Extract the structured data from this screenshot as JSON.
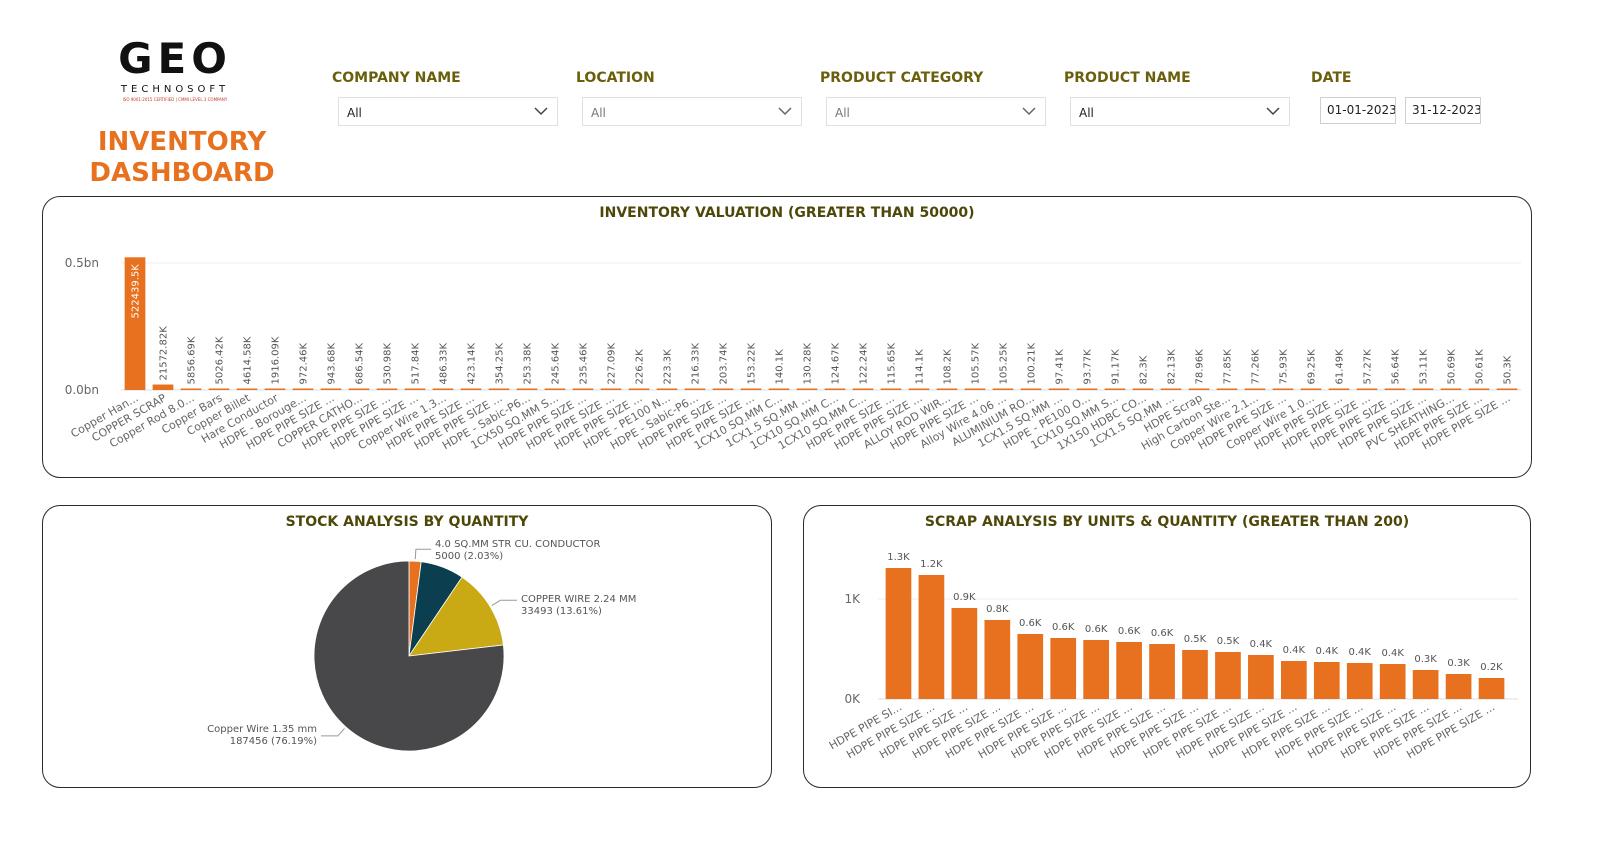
{
  "brand": {
    "logo_text": "GEO",
    "logo_sub": "TECHNOSOFT",
    "logo_cert": "ISO 9001:2015 CERTIFIED | CMMI LEVEL 3 COMPANY",
    "title_line1": "INVENTORY",
    "title_line2": "DASHBOARD"
  },
  "filters": {
    "company": {
      "label": "COMPANY NAME",
      "value": "All"
    },
    "location": {
      "label": "LOCATION",
      "value": "All"
    },
    "category": {
      "label": "PRODUCT CATEGORY",
      "value": "All"
    },
    "product": {
      "label": "PRODUCT NAME",
      "value": "All"
    },
    "date": {
      "label": "DATE",
      "from": "01-01-2023",
      "to": "31-12-2023"
    }
  },
  "colors": {
    "accent": "#e8711f",
    "title": "#4e470a",
    "pie": [
      "#e8711f",
      "#0b3f4f",
      "#c9a914",
      "#48484a"
    ]
  },
  "chart_data": [
    {
      "type": "bar",
      "title": "INVENTORY VALUATION (GREATER THAN 50000)",
      "yticks": [
        "0.0bn",
        "0.5bn"
      ],
      "ylim": [
        0,
        0.5
      ],
      "categories": [
        "Copper Han...",
        "COPPER SCRAP",
        "Copper Rod 8.0...",
        "Copper Bars",
        "Copper Billet",
        "Hare Conductor",
        "HDPE - Borouge...",
        "HDPE PIPE SIZE ...",
        "COPPER CATHO...",
        "HDPE PIPE SIZE ...",
        "HDPE PIPE SIZE ...",
        "Copper Wire 1.3...",
        "HDPE PIPE SIZE ...",
        "HDPE PIPE SIZE ...",
        "HDPE - Sabic-P6...",
        "1CX50 SQ.MM S...",
        "HDPE PIPE SIZE ...",
        "HDPE PIPE SIZE ...",
        "HDPE PIPE SIZE ...",
        "HDPE - PE100 N...",
        "HDPE - Sabic-P6...",
        "HDPE PIPE SIZE ...",
        "HDPE PIPE SIZE ...",
        "1CX10 SQ.MM C...",
        "1CX1.5 SQ.MM ...",
        "1CX10 SQ.MM C...",
        "1CX10 SQ.MM C...",
        "HDPE PIPE SIZE ...",
        "HDPE PIPE SIZE ...",
        "ALLOY ROD WIR...",
        "HDPE PIPE SIZE ...",
        "Alloy Wire 4.06 ...",
        "ALUMINIUM RO...",
        "1CX1.5 SQ.MM ...",
        "HDPE - PE100 O...",
        "1CX10 SQ.MM S...",
        "1X150 HDBC CO...",
        "1CX1.5 SQ.MM ...",
        "HDPE Scrap",
        "High Carbon Ste...",
        "Copper Wire 2.1...",
        "HDPE PIPE SIZE ...",
        "Copper Wire 1.0...",
        "HDPE PIPE SIZE ...",
        "HDPE PIPE SIZE ...",
        "HDPE PIPE SIZE ...",
        "HDPE PIPE SIZE ...",
        "PVC SHEATHING...",
        "HDPE PIPE SIZE ...",
        "HDPE PIPE SIZE ..."
      ],
      "values": [
        522439.5,
        21572.82,
        5856.69,
        5026.42,
        4614.58,
        1916.09,
        972.46,
        943.68,
        686.54,
        530.98,
        517.84,
        486.33,
        423.14,
        354.25,
        253.38,
        245.64,
        235.46,
        227.09,
        226.2,
        223.3,
        216.33,
        203.74,
        153.22,
        140.1,
        130.28,
        124.67,
        122.24,
        115.65,
        114.1,
        108.2,
        105.57,
        105.25,
        100.21,
        97.41,
        93.77,
        91.17,
        82.3,
        82.13,
        78.96,
        77.85,
        77.26,
        75.93,
        69.25,
        61.49,
        57.27,
        56.64,
        53.11,
        50.69,
        50.61,
        50.3
      ],
      "labels": [
        "522439.5K",
        "21572.82K",
        "5856.69K",
        "5026.42K",
        "4614.58K",
        "1916.09K",
        "972.46K",
        "943.68K",
        "686.54K",
        "530.98K",
        "517.84K",
        "486.33K",
        "423.14K",
        "354.25K",
        "253.38K",
        "245.64K",
        "235.46K",
        "227.09K",
        "226.2K",
        "223.3K",
        "216.33K",
        "203.74K",
        "153.22K",
        "140.1K",
        "130.28K",
        "124.67K",
        "122.24K",
        "115.65K",
        "114.1K",
        "108.2K",
        "105.57K",
        "105.25K",
        "100.21K",
        "97.41K",
        "93.77K",
        "91.17K",
        "82.3K",
        "82.13K",
        "78.96K",
        "77.85K",
        "77.26K",
        "75.93K",
        "69.25K",
        "61.49K",
        "57.27K",
        "56.64K",
        "53.11K",
        "50.69K",
        "50.61K",
        "50.3K"
      ]
    },
    {
      "type": "pie",
      "title": "STOCK ANALYSIS BY QUANTITY",
      "slices": [
        {
          "name": "4.0 SQ.MM STR CU. CONDUCTOR",
          "value": 5000,
          "label": "5000 (2.03%)"
        },
        {
          "name": "",
          "value": 17985,
          "label": ""
        },
        {
          "name": "COPPER WIRE 2.24 MM",
          "value": 33493,
          "label": "33493 (13.61%)"
        },
        {
          "name": "Copper Wire 1.35 mm",
          "value": 187456,
          "label": "187456 (76.19%)"
        }
      ]
    },
    {
      "type": "bar",
      "title": "SCRAP ANALYSIS BY UNITS & QUANTITY (GREATER THAN 200)",
      "yticks": [
        "0K",
        "1K"
      ],
      "ylim": [
        0,
        1.4
      ],
      "categories": [
        "HDPE PIPE SI...",
        "HDPE PIPE SIZE ...",
        "HDPE PIPE SIZE ...",
        "HDPE PIPE SIZE ...",
        "HDPE PIPE SIZE ...",
        "HDPE PIPE SIZE ...",
        "HDPE PIPE SIZE ...",
        "HDPE PIPE SIZE ...",
        "HDPE PIPE SIZE ...",
        "HDPE PIPE SIZE ...",
        "HDPE PIPE SIZE ...",
        "HDPE PIPE SIZE ...",
        "HDPE PIPE SIZE ...",
        "HDPE PIPE SIZE ...",
        "HDPE PIPE SIZE ...",
        "HDPE PIPE SIZE ...",
        "HDPE PIPE SIZE ...",
        "HDPE PIPE SIZE ...",
        "HDPE PIPE SIZE ..."
      ],
      "values": [
        1.31,
        1.24,
        0.91,
        0.79,
        0.65,
        0.61,
        0.59,
        0.57,
        0.55,
        0.49,
        0.47,
        0.44,
        0.38,
        0.37,
        0.36,
        0.35,
        0.29,
        0.25,
        0.21
      ],
      "labels": [
        "1.3K",
        "1.2K",
        "0.9K",
        "0.8K",
        "0.6K",
        "0.6K",
        "0.6K",
        "0.6K",
        "0.6K",
        "0.5K",
        "0.5K",
        "0.4K",
        "0.4K",
        "0.4K",
        "0.4K",
        "0.4K",
        "0.3K",
        "0.3K",
        "0.2K"
      ]
    }
  ]
}
